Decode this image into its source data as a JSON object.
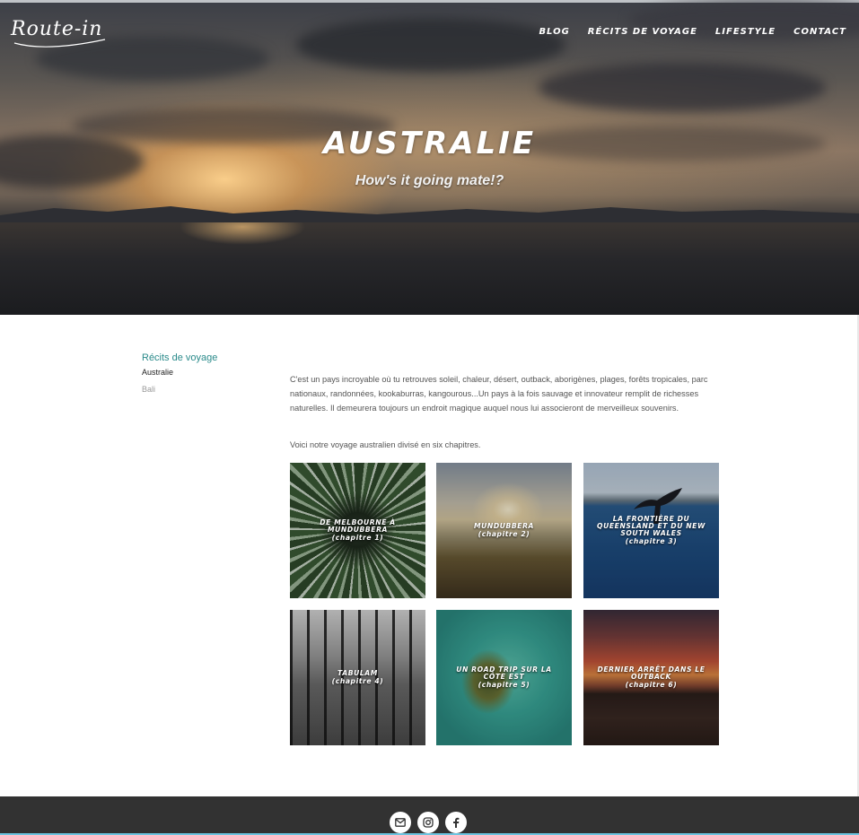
{
  "header": {
    "logo_text": "Route-in",
    "nav": [
      {
        "label": "BLOG"
      },
      {
        "label": "RÉCITS DE VOYAGE"
      },
      {
        "label": "LIFESTYLE"
      },
      {
        "label": "CONTACT"
      }
    ]
  },
  "hero": {
    "title": "AUSTRALIE",
    "subtitle": "How's it going mate!?"
  },
  "sidebar": {
    "category": "Récits de voyage",
    "items": [
      {
        "label": "Australie",
        "active": true
      },
      {
        "label": "Bali",
        "active": false
      }
    ]
  },
  "content": {
    "intro": "C'est un pays incroyable où tu retrouves soleil, chaleur, désert, outback, aborigènes, plages, forêts tropicales, parc nationaux, randonnées, kookaburras, kangourous...Un pays à la fois sauvage et innovateur remplit de richesses naturelles. Il demeurera toujours un endroit magique auquel nous lui associeront de merveilleux souvenirs.",
    "chapters_intro": "Voici notre voyage australien divisé en six chapitres.",
    "chapters": [
      {
        "title": "De Melbourne à Mundubbera",
        "subtitle": "(chapitre 1)"
      },
      {
        "title": "Mundubbera",
        "subtitle": "(chapitre 2)"
      },
      {
        "title": "La frontière du Queensland et du New South Wales",
        "subtitle": "(chapitre 3)"
      },
      {
        "title": "Tabulam",
        "subtitle": "(chapitre 4)"
      },
      {
        "title": "Un road trip sur la côte est",
        "subtitle": "(chapitre 5)"
      },
      {
        "title": "Dernier arrêt dans le Outback",
        "subtitle": "(chapitre 6)"
      }
    ]
  },
  "footer": {
    "social": [
      {
        "icon": "mail-icon"
      },
      {
        "icon": "instagram-icon"
      },
      {
        "icon": "facebook-icon"
      }
    ]
  }
}
